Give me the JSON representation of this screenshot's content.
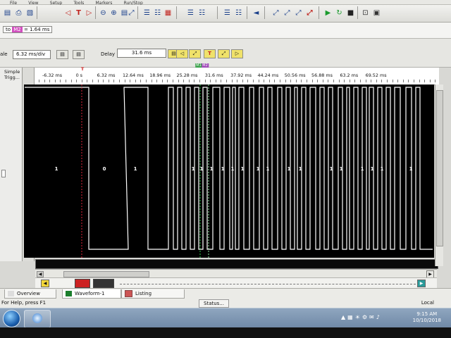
{
  "menubar": {
    "items": [
      "File",
      "View",
      "Setup",
      "Tools",
      "Markers",
      "Run/Stop"
    ]
  },
  "toolbar": {
    "icons": [
      "save-icon",
      "print-icon",
      "print-preview-icon",
      "marker-left-icon",
      "trigger-icon",
      "marker-right-icon",
      "zoom-out-icon",
      "zoom-in-icon",
      "zoom-fit-icon",
      "split-icon",
      "bus-icon",
      "list-icon",
      "expand-icon",
      "collapse-icon",
      "overlay-icon",
      "speaker-icon",
      "line-icon",
      "sweep-icon",
      "scroll-icon",
      "trigger-line-icon",
      "run-icon",
      "run-repetitive-icon",
      "stop-icon",
      "grid-icon",
      "window-icon"
    ]
  },
  "markers": {
    "label": "to",
    "m2_label": "M2",
    "value": "= 1.64 ms"
  },
  "timebase": {
    "scale_label": "ale",
    "scale_value": "6.32 ms/div",
    "delay_label": "Delay",
    "delay_value": "31.6 ms"
  },
  "left_panel": {
    "line1": "Simple",
    "line2": "Trigg...",
    "expand_button": "+"
  },
  "ruler": {
    "ticks": [
      "-6.32 ms",
      "0 s",
      "6.32 ms",
      "12.64 ms",
      "18.96 ms",
      "25.28 ms",
      "31.6 ms",
      "37.92 ms",
      "44.24 ms",
      "50.56 ms",
      "56.88 ms",
      "63.2 ms",
      "69.52 ms"
    ],
    "trigger_marker": "T",
    "m1_tag": "M1",
    "m2_tag": "M2"
  },
  "waveform": {
    "segment_labels": [
      "1",
      "0",
      "1",
      "1",
      "1",
      "1",
      "1",
      "1",
      "1",
      "1",
      "1",
      "1",
      "1",
      "1",
      "1",
      "1",
      "1",
      "1",
      "1"
    ],
    "colors": {
      "signal": "#ffffff",
      "trigger": "#e0253a",
      "m1": "#2bd04a",
      "m2": "#8ee9a0",
      "background": "#000000"
    }
  },
  "tabs": [
    {
      "label": "Overview",
      "icon": "overview-icon"
    },
    {
      "label": "Waveform-1",
      "icon": "waveform-icon"
    },
    {
      "label": "Listing",
      "icon": "listing-icon"
    }
  ],
  "status": {
    "help": "For Help, press F1",
    "status_button": "Status...",
    "mode": "Local"
  },
  "taskbar": {
    "time": "9:15 AM",
    "date": "10/10/2018"
  }
}
